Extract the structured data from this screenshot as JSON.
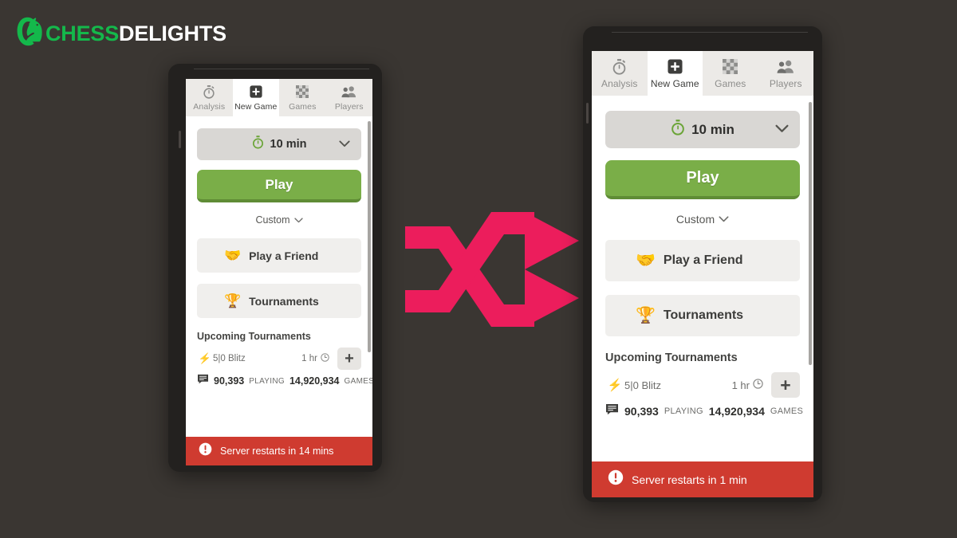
{
  "page": {
    "background_color": "#3a3632",
    "accent_pink": "#ec1d5c",
    "brand_green": "#14b84b"
  },
  "logo": {
    "mark_name": "chess-knight-c-logo",
    "text_primary": "CHESS",
    "text_secondary": "DELIGHTS",
    "primary_color": "#14b84b",
    "secondary_color": "#ffffff"
  },
  "center_graphic": {
    "icon": "shuffle-arrows-icon",
    "color": "#ec1d5c"
  },
  "app": {
    "tabs": [
      {
        "label": "Analysis",
        "icon": "stopwatch-icon",
        "active": false
      },
      {
        "label": "New Game",
        "icon": "plus-square-icon",
        "active": true
      },
      {
        "label": "Games",
        "icon": "chessboard-icon",
        "active": false
      },
      {
        "label": "Players",
        "icon": "players-icon",
        "active": false
      }
    ],
    "time_control": {
      "icon": "stopwatch-green-icon",
      "value": "10 min",
      "chevron": "chevron-down-icon"
    },
    "play_button": {
      "label": "Play",
      "color": "#7aae48"
    },
    "custom": {
      "label": "Custom",
      "chevron": "chevron-down-icon"
    },
    "quick_links": [
      {
        "label": "Play a Friend",
        "emoji": "🤝",
        "icon": "handshake-icon"
      },
      {
        "label": "Tournaments",
        "emoji": "🏆",
        "icon": "trophy-icon"
      }
    ],
    "tournaments": {
      "section_title": "Upcoming Tournaments",
      "rows": [
        {
          "bolt": "⚡",
          "name": "5|0 Blitz",
          "time": "1 hr",
          "clock_icon": "clock-icon",
          "add_label": "+"
        }
      ]
    },
    "stats": {
      "chat_icon": "chat-bubble-icon",
      "playing_count": "90,393",
      "playing_label": "PLAYING",
      "games_count": "14,920,934",
      "games_label": "GAMES"
    }
  },
  "phone_left": {
    "banner": {
      "icon": "alert-circle-icon",
      "label": "Server restarts in 14 mins",
      "color": "#cf3b30"
    }
  },
  "phone_right": {
    "banner": {
      "icon": "alert-circle-icon",
      "label": "Server restarts in 1 min",
      "color": "#cf3b30"
    }
  }
}
